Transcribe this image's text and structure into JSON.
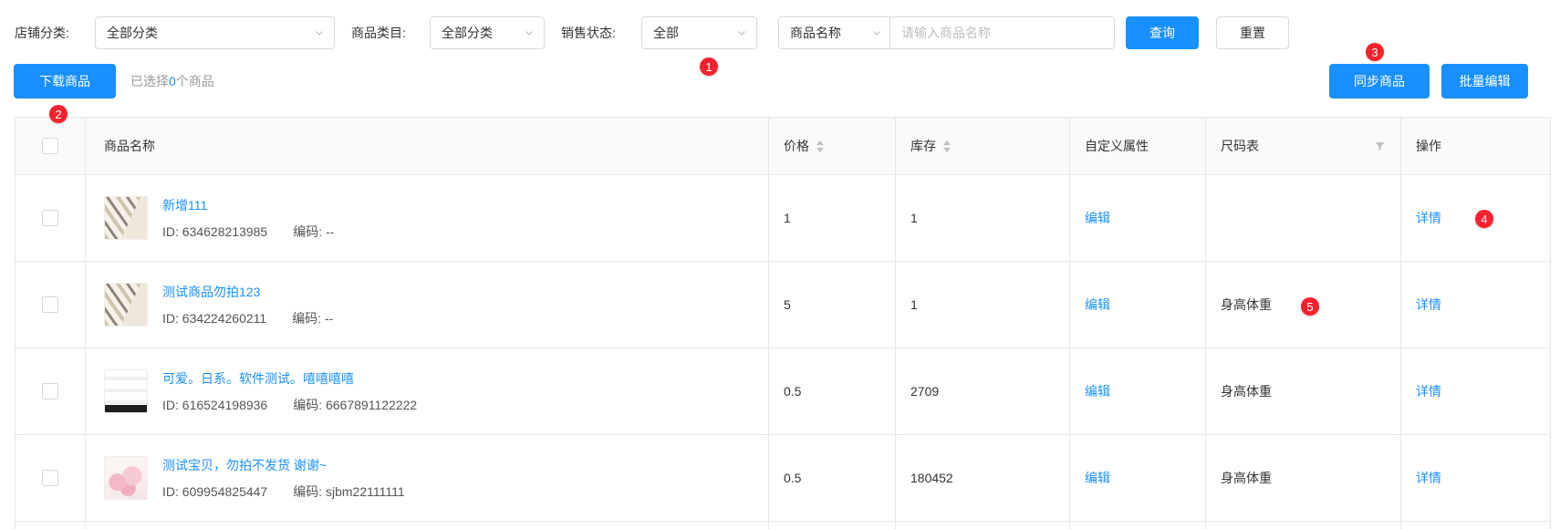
{
  "colors": {
    "primary": "#1890ff",
    "badge_red": "#f5222d",
    "header_bg": "#fafafa",
    "border": "#e8e8e8"
  },
  "filters": {
    "shop_category": {
      "label": "店铺分类:",
      "value": "全部分类"
    },
    "product_category": {
      "label": "商品类目:",
      "value": "全部分类"
    },
    "sale_status": {
      "label": "销售状态:",
      "value": "全部"
    },
    "name_search": {
      "select_value": "商品名称",
      "placeholder": "请输入商品名称",
      "input_value": ""
    },
    "query_label": "查询",
    "reset_label": "重置"
  },
  "toolbar": {
    "download_label": "下载商品",
    "selected_prefix": "已选择",
    "selected_count": "0",
    "selected_suffix": "个商品",
    "sync_label": "同步商品",
    "batch_edit_label": "批量编辑"
  },
  "annotations": {
    "markers": [
      "1",
      "2",
      "3",
      "4",
      "5"
    ]
  },
  "table": {
    "headers": {
      "name": "商品名称",
      "price": "价格",
      "stock": "库存",
      "custom_attr": "自定义属性",
      "size_chart": "尺码表",
      "actions": "操作"
    },
    "rows": [
      {
        "title": "新增111",
        "id_label": "ID: 634628213985",
        "code_label": "编码: --",
        "price": "1",
        "stock": "1",
        "edit": "编辑",
        "size_chart": "",
        "detail": "详情"
      },
      {
        "title": "测试商品勿拍123",
        "id_label": "ID: 634224260211",
        "code_label": "编码: --",
        "price": "5",
        "stock": "1",
        "edit": "编辑",
        "size_chart": "身高体重",
        "detail": "详情"
      },
      {
        "title": "可爱。日系。软件测试。嘻嘻嘻嘻",
        "id_label": "ID: 616524198936",
        "code_label": "编码: 6667891122222",
        "price": "0.5",
        "stock": "2709",
        "edit": "编辑",
        "size_chart": "身高体重",
        "detail": "详情"
      },
      {
        "title": "测试宝贝，勿拍不发货 谢谢~",
        "id_label": "ID: 609954825447",
        "code_label": "编码: sjbm22111111",
        "price": "0.5",
        "stock": "180452",
        "edit": "编辑",
        "size_chart": "身高体重",
        "detail": "详情"
      }
    ]
  }
}
